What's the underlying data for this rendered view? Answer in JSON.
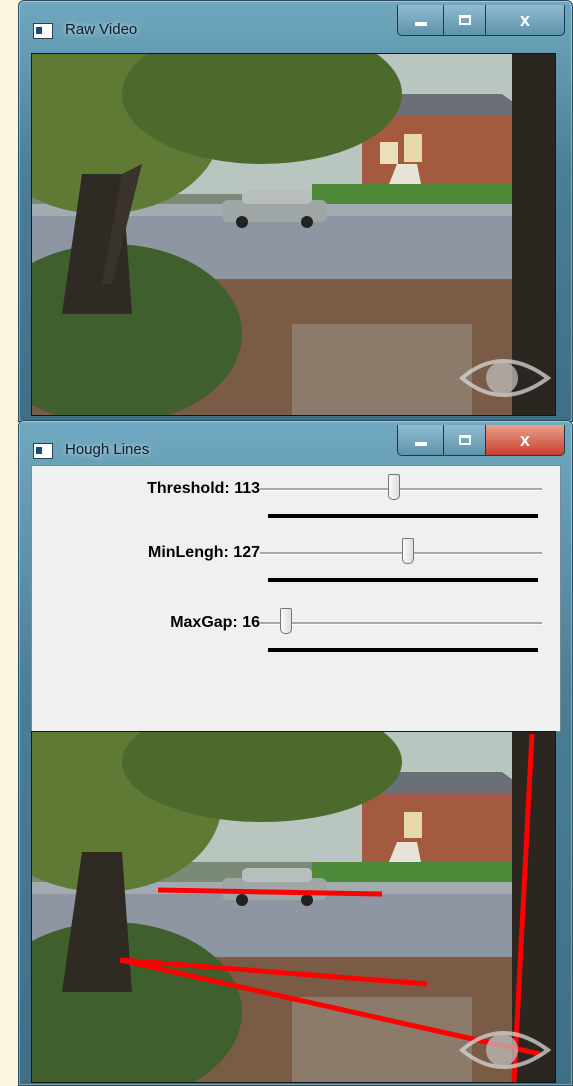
{
  "raw_window": {
    "title": "Raw Video",
    "minimize_symbol": "",
    "maximize_symbol": "",
    "close_symbol": "x"
  },
  "hough_window": {
    "title": "Hough Lines",
    "close_symbol": "x",
    "trackbars": [
      {
        "label": "Threshold: 113",
        "value": 113,
        "fraction": 0.47
      },
      {
        "label": "MinLengh: 127",
        "value": 127,
        "fraction": 0.52
      },
      {
        "label": "MaxGap: 16",
        "value": 16,
        "fraction": 0.09
      }
    ]
  },
  "colors": {
    "hough_line": "#ff0000",
    "title_bar": "#4b7f96",
    "close_active": "#c8402a"
  },
  "icons": [
    "app-window-icon",
    "minimize-icon",
    "maximize-icon",
    "close-icon",
    "eye-watermark-icon"
  ]
}
